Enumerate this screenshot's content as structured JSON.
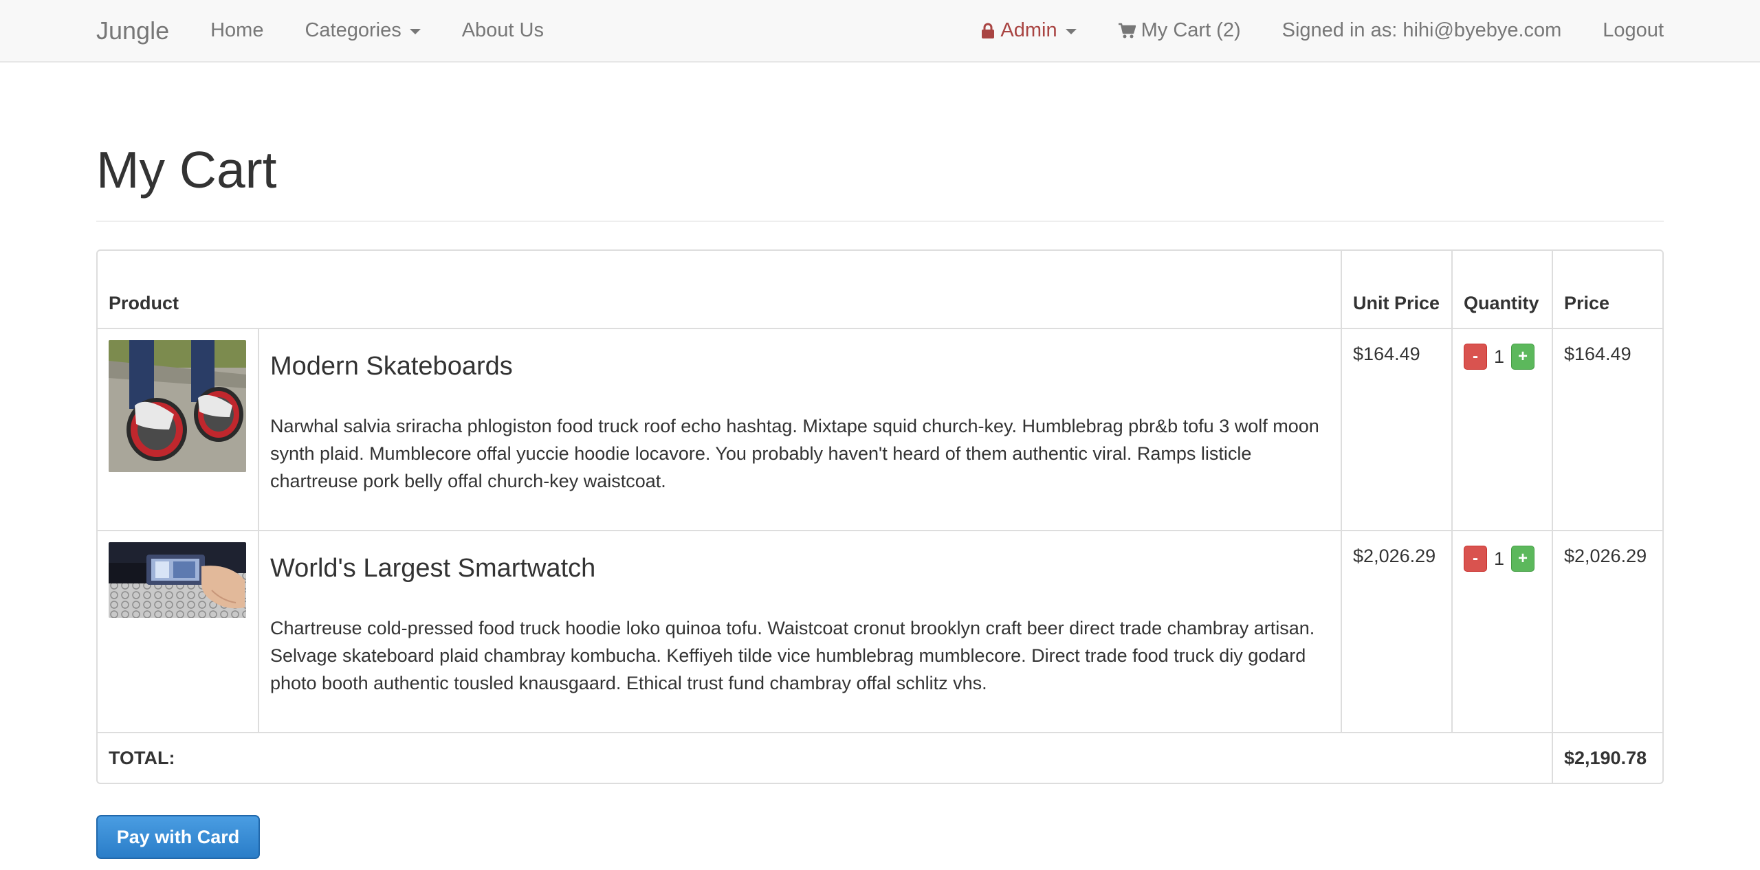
{
  "navbar": {
    "brand": "Jungle",
    "links": {
      "home": "Home",
      "categories": "Categories",
      "about": "About Us"
    },
    "right": {
      "admin": "Admin",
      "cart": "My Cart (2)",
      "signed_in": "Signed in as: hihi@byebye.com",
      "logout": "Logout"
    },
    "admin_color": "#a94442"
  },
  "page": {
    "title": "My Cart"
  },
  "table": {
    "headers": {
      "product": "Product",
      "unit_price": "Unit Price",
      "quantity": "Quantity",
      "price": "Price"
    },
    "rows": [
      {
        "name": "Modern Skateboards",
        "description": "Narwhal salvia sriracha phlogiston food truck roof echo hashtag. Mixtape squid church-key. Humblebrag pbr&b tofu 3 wolf moon synth plaid. Mumblecore offal yuccie hoodie locavore. You probably haven't heard of them authentic viral. Ramps listicle chartreuse pork belly offal church-key waistcoat.",
        "unit_price": "$164.49",
        "quantity": "1",
        "price": "$164.49",
        "image": "skateboards-image"
      },
      {
        "name": "World's Largest Smartwatch",
        "description": "Chartreuse cold-pressed food truck hoodie loko quinoa tofu. Waistcoat cronut brooklyn craft beer direct trade chambray artisan. Selvage skateboard plaid chambray kombucha. Keffiyeh tilde vice humblebrag mumblecore. Direct trade food truck diy godard photo booth authentic tousled knausgaard. Ethical trust fund chambray offal schlitz vhs.",
        "unit_price": "$2,026.29",
        "quantity": "1",
        "price": "$2,026.29",
        "image": "smartwatch-image"
      }
    ],
    "minus_label": "-",
    "plus_label": "+",
    "total_label": "TOTAL:",
    "total_value": "$2,190.78"
  },
  "actions": {
    "pay_label": "Pay with Card"
  },
  "colors": {
    "minus": "#d9534f",
    "plus": "#5cb85c",
    "pay": "#2a7dc8"
  }
}
